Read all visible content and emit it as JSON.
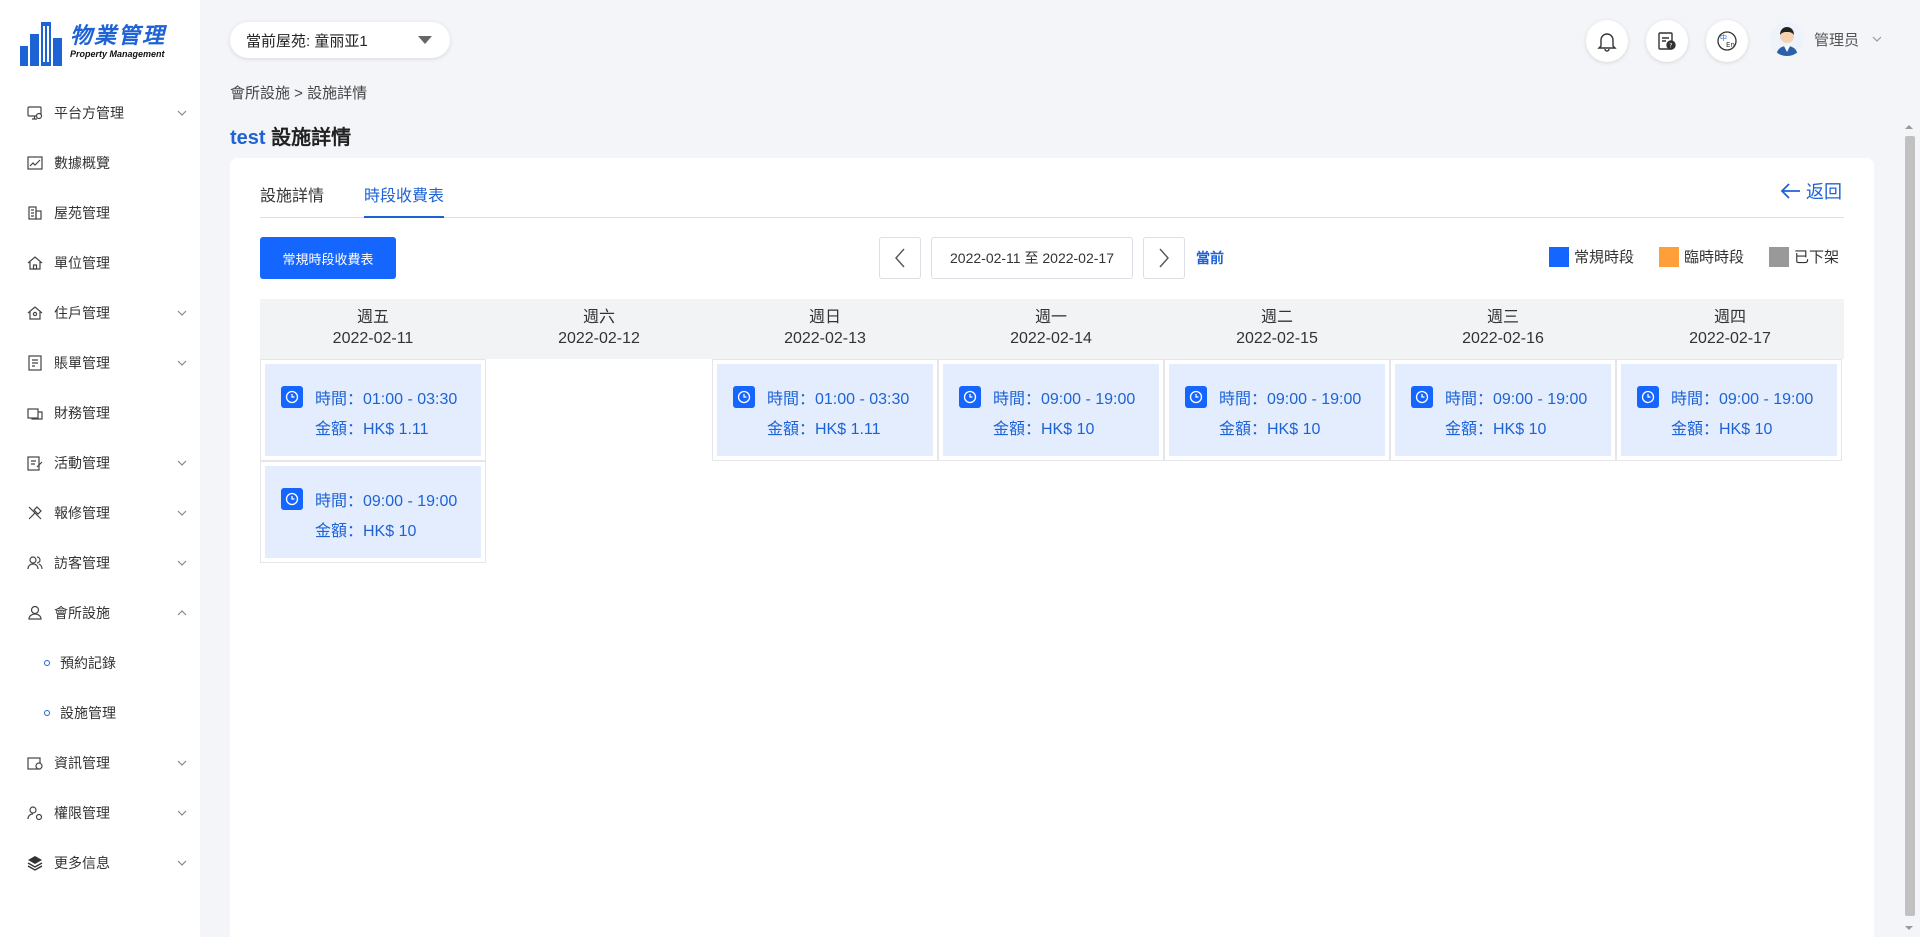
{
  "sidebar": {
    "logo": {
      "cn": "物業管理",
      "en": "Property Management"
    },
    "items": [
      {
        "label": "平台方管理",
        "icon": "monitor-settings-icon",
        "expandable": true
      },
      {
        "label": "數據概覽",
        "icon": "chart-line-icon",
        "expandable": false
      },
      {
        "label": "屋苑管理",
        "icon": "building-icon",
        "expandable": false
      },
      {
        "label": "單位管理",
        "icon": "home-icon",
        "expandable": false
      },
      {
        "label": "住戶管理",
        "icon": "house-user-icon",
        "expandable": true
      },
      {
        "label": "賬單管理",
        "icon": "bill-icon",
        "expandable": true
      },
      {
        "label": "財務管理",
        "icon": "finance-icon",
        "expandable": false
      },
      {
        "label": "活動管理",
        "icon": "edit-doc-icon",
        "expandable": true
      },
      {
        "label": "報修管理",
        "icon": "tools-icon",
        "expandable": true
      },
      {
        "label": "訪客管理",
        "icon": "visitors-icon",
        "expandable": true
      },
      {
        "label": "會所設施",
        "icon": "facility-icon",
        "expandable": true,
        "open": true,
        "children": [
          {
            "label": "預約記錄"
          },
          {
            "label": "設施管理"
          }
        ]
      },
      {
        "label": "資訊管理",
        "icon": "info-doc-icon",
        "expandable": true
      },
      {
        "label": "權限管理",
        "icon": "user-key-icon",
        "expandable": true
      },
      {
        "label": "更多信息",
        "icon": "layers-icon",
        "expandable": true
      }
    ]
  },
  "header": {
    "estate_label": "當前屋苑: 童丽亚1",
    "user_name": "管理员"
  },
  "breadcrumb": "會所設施 > 設施詳情",
  "title": {
    "name": "test",
    "suffix": " 設施詳情"
  },
  "tabs": [
    {
      "label": "設施詳情",
      "active": false
    },
    {
      "label": "時段收費表",
      "active": true
    }
  ],
  "back_label": "返回",
  "toolbar": {
    "regular_button": "常規時段收費表",
    "date_range": "2022-02-11 至 2022-02-17",
    "today_label": "當前"
  },
  "legend": [
    {
      "label": "常規時段",
      "color": "#1565ff"
    },
    {
      "label": "臨時時段",
      "color": "#ff9f3a"
    },
    {
      "label": "已下架",
      "color": "#999999"
    }
  ],
  "days": [
    {
      "weekday": "週五",
      "date": "2022-02-11",
      "slots": [
        {
          "time": "時間：01:00 - 03:30",
          "amount": "金額：HK$ 1.11"
        },
        {
          "time": "時間：09:00 - 19:00",
          "amount": "金額：HK$ 10"
        }
      ]
    },
    {
      "weekday": "週六",
      "date": "2022-02-12",
      "slots": []
    },
    {
      "weekday": "週日",
      "date": "2022-02-13",
      "slots": [
        {
          "time": "時間：01:00 - 03:30",
          "amount": "金額：HK$ 1.11"
        }
      ]
    },
    {
      "weekday": "週一",
      "date": "2022-02-14",
      "slots": [
        {
          "time": "時間：09:00 - 19:00",
          "amount": "金額：HK$ 10"
        }
      ]
    },
    {
      "weekday": "週二",
      "date": "2022-02-15",
      "slots": [
        {
          "time": "時間：09:00 - 19:00",
          "amount": "金額：HK$ 10"
        }
      ]
    },
    {
      "weekday": "週三",
      "date": "2022-02-16",
      "slots": [
        {
          "time": "時間：09:00 - 19:00",
          "amount": "金額：HK$ 10"
        }
      ]
    },
    {
      "weekday": "週四",
      "date": "2022-02-17",
      "slots": [
        {
          "time": "時間：09:00 - 19:00",
          "amount": "金額：HK$ 10"
        }
      ]
    }
  ]
}
